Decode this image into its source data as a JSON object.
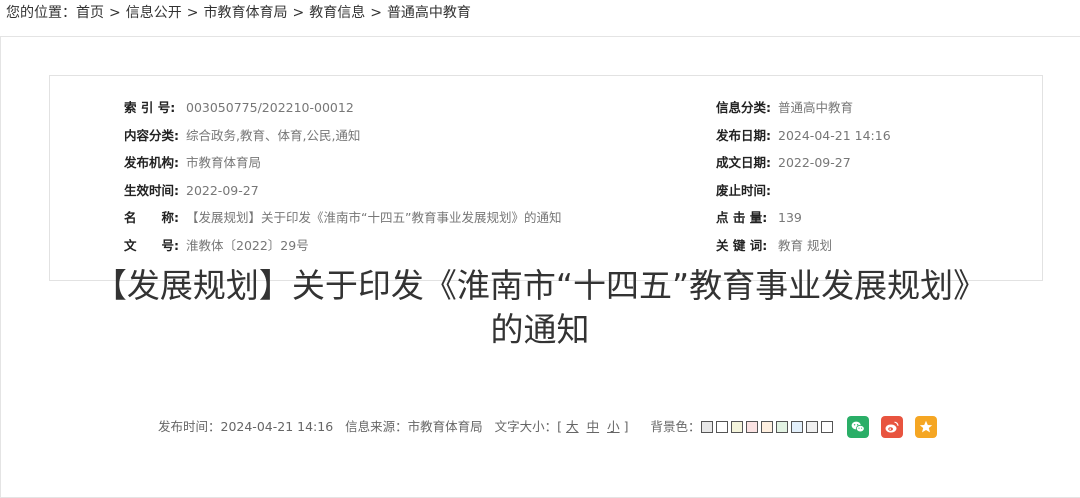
{
  "breadcrumb": {
    "prefix": "您的位置：",
    "items": [
      "首页",
      "信息公开",
      "市教育体育局",
      "教育信息",
      "普通高中教育"
    ],
    "separator": ">"
  },
  "meta": {
    "left": [
      {
        "label": "索 引 号:",
        "value": "003050775/202210-00012"
      },
      {
        "label": "内容分类:",
        "value": "综合政务,教育、体育,公民,通知"
      },
      {
        "label": "发布机构:",
        "value": "市教育体育局"
      },
      {
        "label": "生效时间:",
        "value": "2022-09-27"
      },
      {
        "label": "名　　称:",
        "value": "【发展规划】关于印发《淮南市“十四五”教育事业发展规划》的通知"
      },
      {
        "label": "文　　号:",
        "value": "淮教体〔2022〕29号"
      }
    ],
    "right": [
      {
        "label": "信息分类:",
        "value": "普通高中教育"
      },
      {
        "label": "发布日期:",
        "value": "2024-04-21 14:16"
      },
      {
        "label": "成文日期:",
        "value": "2022-09-27"
      },
      {
        "label": "废止时间:",
        "value": ""
      },
      {
        "label": "点 击 量:",
        "value": "139"
      },
      {
        "label": "关 键 词:",
        "value": "教育 规划"
      }
    ]
  },
  "title": {
    "line1": "【发展规划】关于印发《淮南市“十四五”教育事业发展规划》",
    "line2": "的通知"
  },
  "info_bar": {
    "publish_time": "发布时间：2024-04-21 14:16",
    "source": "信息来源：市教育体育局",
    "font_size_label": "文字大小：[",
    "font_size_close": "]",
    "font_sizes": [
      "大",
      "中",
      "小"
    ],
    "bg_color_label": "背景色：",
    "bg_colors": [
      "#e8e8e8",
      "#ffffff",
      "#f5f5dc",
      "#fbe3e3",
      "#fff0e0",
      "#e3f3e3",
      "#e3f0fb",
      "#f0f0f0",
      "#ffffff"
    ],
    "share": [
      {
        "name": "wechat-share-icon",
        "color": "#2aae67"
      },
      {
        "name": "weibo-share-icon",
        "color": "#e8543f"
      },
      {
        "name": "favorite-star-icon",
        "color": "#f5a623"
      }
    ]
  }
}
